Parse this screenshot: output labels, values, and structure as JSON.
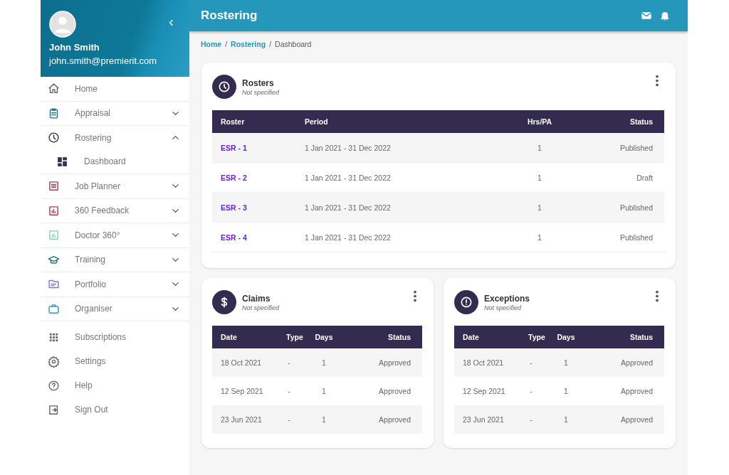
{
  "profile": {
    "name": "John Smith",
    "email": "john.smith@premierit.com",
    "collapse": "‹"
  },
  "sidebar": {
    "items": [
      {
        "kind": "link",
        "label": "Home"
      },
      {
        "kind": "group",
        "label": "Appraisal",
        "expanded": false
      },
      {
        "kind": "group",
        "label": "Rostering",
        "expanded": true,
        "children": [
          {
            "label": "Dashboard"
          }
        ]
      },
      {
        "kind": "group",
        "label": "Job Planner",
        "expanded": false
      },
      {
        "kind": "group",
        "label": "360 Feedback",
        "expanded": false
      },
      {
        "kind": "group",
        "label": "Doctor 360°",
        "expanded": false
      },
      {
        "kind": "group",
        "label": "Training",
        "expanded": false
      },
      {
        "kind": "group",
        "label": "Portfolio",
        "expanded": false
      },
      {
        "kind": "group",
        "label": "Organiser",
        "expanded": false
      },
      {
        "kind": "footer",
        "label": "Subscriptions"
      },
      {
        "kind": "footer",
        "label": "Settings"
      },
      {
        "kind": "footer",
        "label": "Help"
      },
      {
        "kind": "footer",
        "label": "Sign Out"
      }
    ]
  },
  "header": {
    "title": "Rostering"
  },
  "breadcrumb": [
    {
      "label": "Home",
      "link": true
    },
    {
      "separator": "/",
      "label": "Rostering",
      "link": true
    },
    {
      "separator": "/",
      "label": "Dashboard",
      "link": false
    }
  ],
  "cards": [
    {
      "kind": "rosters",
      "title": "Rosters",
      "subtitle": "Not specified",
      "columns": [
        "Roster",
        "Period",
        "Hrs/PA",
        "Status"
      ],
      "rows": [
        [
          "ESR - 1",
          "1 Jan 2021 - 31 Dec 2022",
          "1",
          "Published"
        ],
        [
          "ESR - 2",
          "1 Jan 2021 - 31 Dec 2022",
          "1",
          "Draft"
        ],
        [
          "ESR - 3",
          "1 Jan 2021 - 31 Dec 2022",
          "1",
          "Published"
        ],
        [
          "ESR - 4",
          "1 Jan 2021 - 31 Dec 2022",
          "1",
          "Published"
        ]
      ]
    },
    {
      "kind": "claims",
      "title": "Claims",
      "subtitle": "Not specified",
      "columns": [
        "Date",
        "Type",
        "Days",
        "Status"
      ],
      "rows": [
        [
          "18 Oct 2021",
          "-",
          "1",
          "Approved"
        ],
        [
          "12 Sep 2021",
          "-",
          "1",
          "Approved"
        ],
        [
          "23 Jun 2021",
          "-",
          "1",
          "Approved"
        ]
      ]
    },
    {
      "kind": "exceptions",
      "title": "Exceptions",
      "subtitle": "Not specified",
      "columns": [
        "Date",
        "Type",
        "Days",
        "Status"
      ],
      "rows": [
        [
          "18 Oct 2021",
          "-",
          "1",
          "Approved"
        ],
        [
          "12 Sep 2021",
          "-",
          "1",
          "Approved"
        ],
        [
          "23 Jun 2021",
          "-",
          "1",
          "Approved"
        ]
      ]
    }
  ]
}
